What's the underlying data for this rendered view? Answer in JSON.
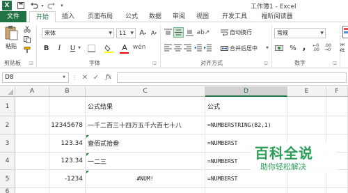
{
  "window": {
    "title": "工作簿1 - Excel",
    "logo": "X"
  },
  "tabs": {
    "file": "文件",
    "home": "开始",
    "insert": "插入",
    "layout": "页面布局",
    "formulas": "公式",
    "data": "数据",
    "review": "审阅",
    "view": "视图",
    "developer": "开发工具",
    "foxit": "福昕阅读器"
  },
  "ribbon": {
    "paste_label": "粘贴",
    "clipboard_label": "剪贴板",
    "font_name": "宋体",
    "font_size": "11",
    "bold": "B",
    "italic": "I",
    "underline": "U",
    "font_color_glyph": "A",
    "font_label": "字体",
    "wrap_text": "自动换行",
    "merge_center": "合并后居中",
    "alignment_label": "对齐方式",
    "number_format": "常规",
    "percent": "%",
    "comma": ",",
    "number_label": "数字",
    "cond_format_partial": "条件"
  },
  "formula_bar": {
    "name_box": "D8",
    "formula": ""
  },
  "grid": {
    "columns": [
      "A",
      "B",
      "C",
      "D",
      "E",
      "F"
    ],
    "rows": [
      "1",
      "2",
      "3",
      "4",
      "5",
      "6"
    ],
    "selected_column": "D",
    "cells": {
      "C1": "公式结果",
      "D1": "公式",
      "B2": "12345678",
      "C2": "一千二百三十四万五千六百七十八",
      "D2": "=NUMBERSTRING(B2,1)",
      "B3": "123.34",
      "C3": "壹佰贰拾叁",
      "D3": "=NUMBERST",
      "B4": "123.34",
      "C4": "一二三",
      "D4": "=NUMBERST",
      "B5": "-1234",
      "C5": "#NUM!",
      "D5": "=NUMBERST"
    }
  },
  "watermark": {
    "title": "百科全说",
    "subtitle": "助你轻松解决"
  },
  "colors": {
    "excel_green": "#217346",
    "watermark_green": "#2a9d57"
  }
}
